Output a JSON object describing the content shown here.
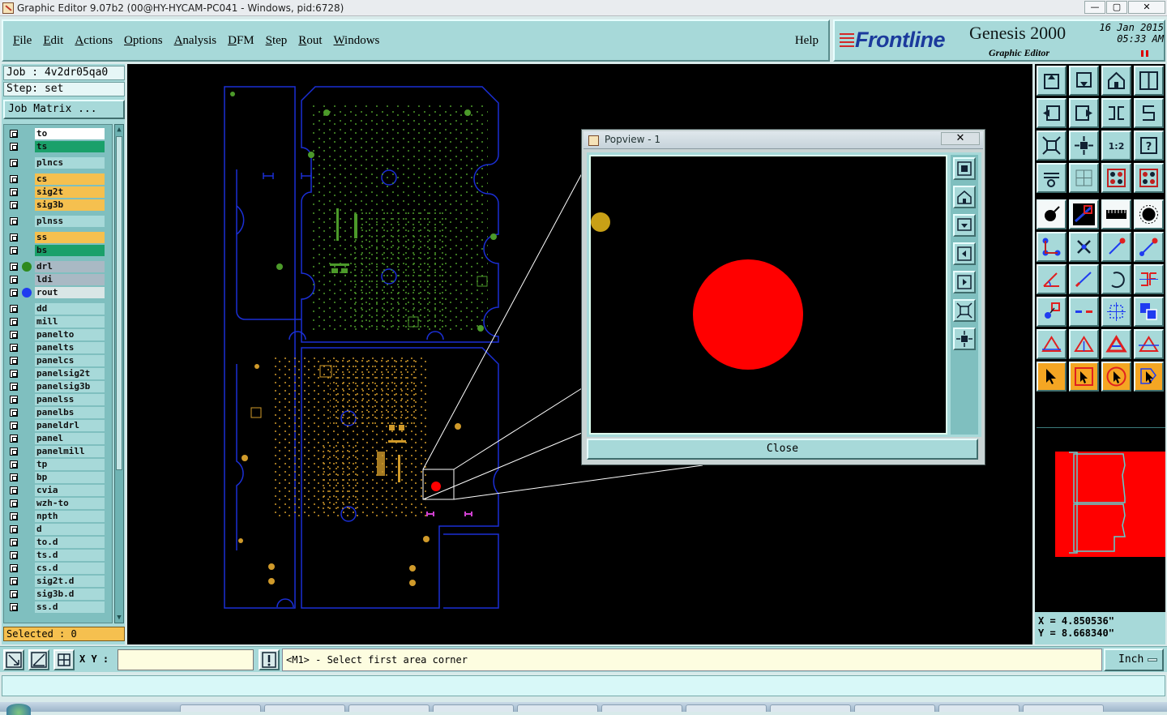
{
  "window": {
    "title": "Graphic Editor 9.07b2 (00@HY-HYCAM-PC041 - Windows, pid:6728)",
    "min_glyph": "—",
    "max_glyph": "▢",
    "close_glyph": "✕"
  },
  "menu": {
    "items": [
      "File",
      "Edit",
      "Actions",
      "Options",
      "Analysis",
      "DFM",
      "Step",
      "Rout",
      "Windows"
    ],
    "help": "Help"
  },
  "brand": {
    "logo": "Frontline",
    "product": "Genesis 2000",
    "subtitle": "Graphic Editor",
    "date": "16 Jan 2015",
    "time": "05:33 AM"
  },
  "left": {
    "job": "Job : 4v2dr05qa0",
    "step": "Step: set",
    "job_matrix": "Job Matrix ...",
    "selected": "Selected : 0",
    "layers": [
      {
        "name": "to",
        "color": "#ffffff",
        "dot": ""
      },
      {
        "name": "ts",
        "color": "#1aa06a",
        "dot": ""
      },
      {
        "name": "plncs",
        "color": "#a7d9d9",
        "dot": ""
      },
      {
        "name": "cs",
        "color": "#f5c04f",
        "dot": ""
      },
      {
        "name": "sig2t",
        "color": "#f5c04f",
        "dot": ""
      },
      {
        "name": "sig3b",
        "color": "#f5c04f",
        "dot": ""
      },
      {
        "name": "plnss",
        "color": "#a7d9d9",
        "dot": ""
      },
      {
        "name": "ss",
        "color": "#f5c04f",
        "dot": ""
      },
      {
        "name": "bs",
        "color": "#1aa06a",
        "dot": ""
      },
      {
        "name": "drl",
        "color": "#a9b9c4",
        "dot": "#2f8a1f"
      },
      {
        "name": "ldi",
        "color": "#a9b9c4",
        "dot": ""
      },
      {
        "name": "rout",
        "color": "#d9e6e6",
        "dot": "#1f3cf0"
      },
      {
        "name": "dd",
        "color": "#a7d9d9",
        "dot": ""
      },
      {
        "name": "mill",
        "color": "#a7d9d9",
        "dot": ""
      },
      {
        "name": "panelto",
        "color": "#a7d9d9",
        "dot": ""
      },
      {
        "name": "panelts",
        "color": "#a7d9d9",
        "dot": ""
      },
      {
        "name": "panelcs",
        "color": "#a7d9d9",
        "dot": ""
      },
      {
        "name": "panelsig2t",
        "color": "#a7d9d9",
        "dot": ""
      },
      {
        "name": "panelsig3b",
        "color": "#a7d9d9",
        "dot": ""
      },
      {
        "name": "panelss",
        "color": "#a7d9d9",
        "dot": ""
      },
      {
        "name": "panelbs",
        "color": "#a7d9d9",
        "dot": ""
      },
      {
        "name": "paneldrl",
        "color": "#a7d9d9",
        "dot": ""
      },
      {
        "name": "panel",
        "color": "#a7d9d9",
        "dot": ""
      },
      {
        "name": "panelmill",
        "color": "#a7d9d9",
        "dot": ""
      },
      {
        "name": "tp",
        "color": "#a7d9d9",
        "dot": ""
      },
      {
        "name": "bp",
        "color": "#a7d9d9",
        "dot": ""
      },
      {
        "name": "cvia",
        "color": "#a7d9d9",
        "dot": ""
      },
      {
        "name": "wzh-to",
        "color": "#a7d9d9",
        "dot": ""
      },
      {
        "name": "npth",
        "color": "#a7d9d9",
        "dot": ""
      },
      {
        "name": "d",
        "color": "#a7d9d9",
        "dot": ""
      },
      {
        "name": "to.d",
        "color": "#a7d9d9",
        "dot": ""
      },
      {
        "name": "ts.d",
        "color": "#a7d9d9",
        "dot": ""
      },
      {
        "name": "cs.d",
        "color": "#a7d9d9",
        "dot": ""
      },
      {
        "name": "sig2t.d",
        "color": "#a7d9d9",
        "dot": ""
      },
      {
        "name": "sig3b.d",
        "color": "#a7d9d9",
        "dot": ""
      },
      {
        "name": "ss.d",
        "color": "#a7d9d9",
        "dot": ""
      }
    ]
  },
  "popview": {
    "title": "Popview - 1",
    "close_glyph": "✕",
    "close_label": "Close"
  },
  "coords": {
    "x": "X = 4.850536\"",
    "y": "Y = 8.668340\""
  },
  "bottom": {
    "xy_label": "X Y :",
    "xy_value": "",
    "warn_glyph": "!",
    "message": "<M1> - Select first area corner",
    "unit": "Inch"
  },
  "colors": {
    "panel": "#a7d9d9",
    "outline": "#1b2fd6",
    "top_layer": "#4c9a2a",
    "bottom_layer": "#d09a2a",
    "highlight": "#ff0000",
    "minimap_fill": "#ff0000",
    "minimap_outline": "#5fd0d0"
  }
}
